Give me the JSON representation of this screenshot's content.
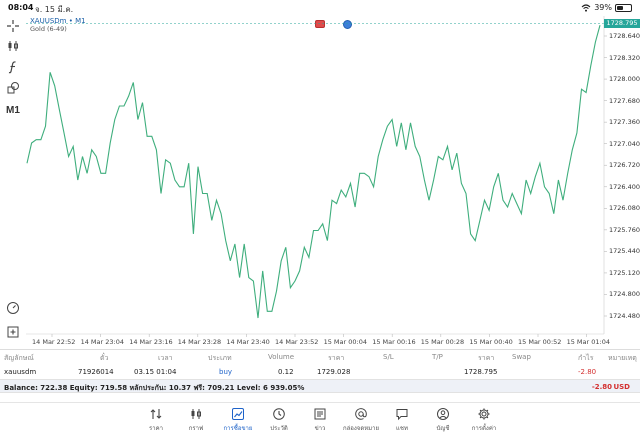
{
  "status_bar": {
    "time": "08:04",
    "date": "จ. 15 มี.ค.",
    "battery": "39%",
    "battery_level": 0.39
  },
  "chart_header": {
    "symbol": "XAUUSDm • M1",
    "description": "Gold (6-49)"
  },
  "left_toolbar": {
    "timeframe": "M1"
  },
  "chart_data": {
    "type": "line",
    "title": "",
    "xlabel": "",
    "ylabel": "",
    "line_color": "#3fae7d",
    "current_price": "1728.795",
    "ylim": [
      1724.2,
      1729.1
    ],
    "y_ticks": [
      "1728.640",
      "1728.320",
      "1728.000",
      "1727.680",
      "1727.360",
      "1727.040",
      "1726.720",
      "1726.400",
      "1726.080",
      "1725.760",
      "1725.440",
      "1725.120",
      "1724.800",
      "1724.480"
    ],
    "x_ticks": [
      "14 Mar 22:52",
      "14 Mar 23:04",
      "14 Mar 23:16",
      "14 Mar 23:28",
      "14 Mar 23:40",
      "14 Mar 23:52",
      "15 Mar 00:04",
      "15 Mar 00:16",
      "15 Mar 00:28",
      "15 Mar 00:40",
      "15 Mar 00:52",
      "15 Mar 01:04"
    ],
    "values": [
      1726.75,
      1727.05,
      1727.1,
      1727.1,
      1727.3,
      1728.1,
      1727.9,
      1727.55,
      1727.2,
      1726.85,
      1727.0,
      1726.5,
      1726.85,
      1726.6,
      1726.95,
      1726.85,
      1726.6,
      1726.6,
      1727.05,
      1727.4,
      1727.6,
      1727.6,
      1727.75,
      1727.95,
      1727.4,
      1727.65,
      1727.15,
      1727.15,
      1726.95,
      1726.3,
      1726.8,
      1726.75,
      1726.5,
      1726.4,
      1726.4,
      1726.75,
      1725.7,
      1726.7,
      1726.3,
      1726.3,
      1725.9,
      1726.2,
      1726.0,
      1725.6,
      1725.3,
      1725.55,
      1725.05,
      1725.55,
      1725.05,
      1725.0,
      1724.45,
      1725.15,
      1724.55,
      1724.55,
      1724.85,
      1725.3,
      1725.5,
      1724.9,
      1725.0,
      1725.15,
      1725.5,
      1725.35,
      1725.75,
      1725.75,
      1725.85,
      1725.6,
      1726.2,
      1726.15,
      1726.35,
      1726.25,
      1726.45,
      1726.1,
      1726.6,
      1726.6,
      1726.55,
      1726.4,
      1726.85,
      1727.1,
      1727.3,
      1727.4,
      1727.0,
      1727.35,
      1726.95,
      1727.35,
      1727.0,
      1726.85,
      1726.5,
      1726.2,
      1726.5,
      1726.85,
      1726.8,
      1727.0,
      1726.65,
      1726.9,
      1726.45,
      1726.3,
      1725.7,
      1725.6,
      1725.9,
      1726.2,
      1726.05,
      1726.4,
      1726.6,
      1726.2,
      1726.1,
      1726.3,
      1726.15,
      1726.0,
      1726.5,
      1726.3,
      1726.55,
      1726.75,
      1726.4,
      1726.3,
      1726.0,
      1726.5,
      1726.2,
      1726.6,
      1726.95,
      1727.2,
      1727.85,
      1727.8,
      1728.2,
      1728.55,
      1728.8
    ]
  },
  "trade_panel": {
    "headers": {
      "symbol": "สัญลักษณ์",
      "ticket": "ตั๋ว",
      "time": "เวลา",
      "type": "ประเภท",
      "volume": "Volume",
      "price": "ราคา",
      "sl": "S/L",
      "tp": "T/P",
      "current": "ราคา",
      "swap": "Swap",
      "profit": "กำไร",
      "comment": "หมายเหตุ"
    },
    "row": {
      "symbol": "xauusdm",
      "ticket": "71926014",
      "time": "03.15 01:04",
      "type": "buy",
      "volume": "0.12",
      "price": "1729.028",
      "current": "1728.795",
      "profit": "-2.80"
    },
    "balance_text": "Balance: 722.38 Equity: 719.58 หลักประกัน: 10.37 ฟรี: 709.21 Level: 6 939.05%",
    "balance_profit": "-2.80",
    "currency": "USD"
  },
  "bottom_nav": [
    {
      "label": "ราคา"
    },
    {
      "label": "กราฟ"
    },
    {
      "label": "การซื้อขาย"
    },
    {
      "label": "ประวัติ"
    },
    {
      "label": "ข่าว"
    },
    {
      "label": "กล่องจดหมาย"
    },
    {
      "label": "แชท"
    },
    {
      "label": "บัญชี"
    },
    {
      "label": "การตั้งค่า"
    }
  ]
}
